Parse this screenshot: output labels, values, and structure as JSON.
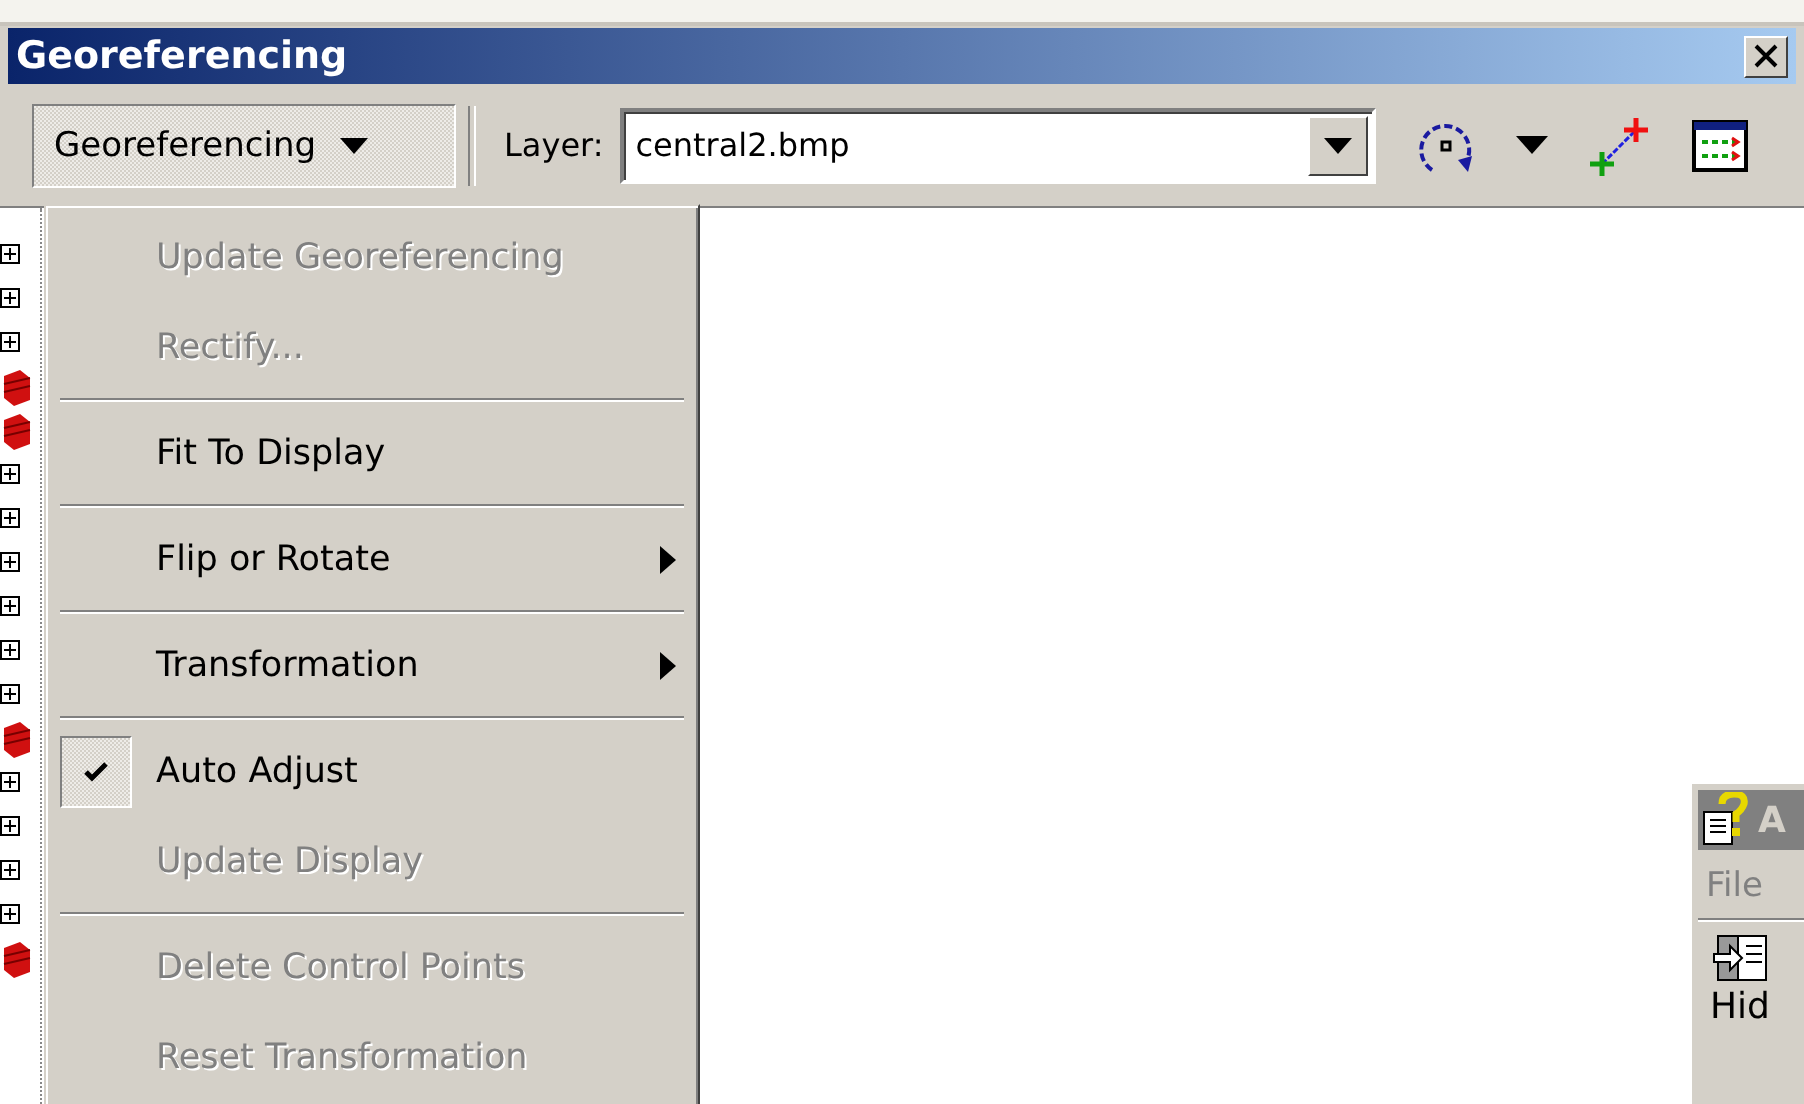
{
  "window": {
    "title": "Georeferencing"
  },
  "toolbar": {
    "menu_button": "Georeferencing",
    "layer_label": "Layer:",
    "layer_value": "central2.bmp"
  },
  "menu": {
    "items": [
      {
        "kind": "item",
        "label": "Update Georeferencing",
        "disabled": true,
        "checked": false,
        "submenu": false
      },
      {
        "kind": "item",
        "label": "Rectify...",
        "disabled": true,
        "checked": false,
        "submenu": false
      },
      {
        "kind": "separator"
      },
      {
        "kind": "item",
        "label": "Fit To Display",
        "disabled": false,
        "checked": false,
        "submenu": false
      },
      {
        "kind": "separator"
      },
      {
        "kind": "item",
        "label": "Flip or Rotate",
        "disabled": false,
        "checked": false,
        "submenu": true
      },
      {
        "kind": "separator"
      },
      {
        "kind": "item",
        "label": "Transformation",
        "disabled": false,
        "checked": false,
        "submenu": true
      },
      {
        "kind": "separator"
      },
      {
        "kind": "item",
        "label": "Auto Adjust",
        "disabled": false,
        "checked": true,
        "submenu": false
      },
      {
        "kind": "item",
        "label": "Update Display",
        "disabled": true,
        "checked": false,
        "submenu": false
      },
      {
        "kind": "separator"
      },
      {
        "kind": "item",
        "label": "Delete Control Points",
        "disabled": true,
        "checked": false,
        "submenu": false
      },
      {
        "kind": "item",
        "label": "Reset Transformation",
        "disabled": true,
        "checked": false,
        "submenu": false
      }
    ]
  },
  "side_window": {
    "title": "A",
    "menu": "File",
    "button": "Hid"
  }
}
